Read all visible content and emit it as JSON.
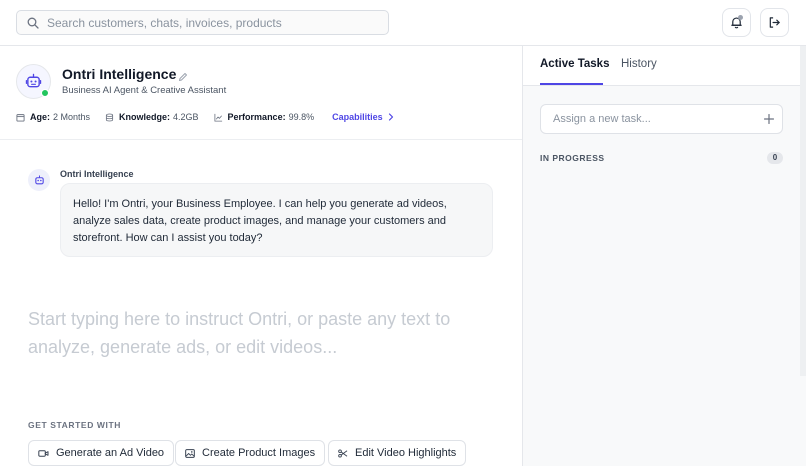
{
  "search": {
    "placeholder": "Search customers, chats, invoices, products"
  },
  "agent": {
    "name": "Ontri Intelligence",
    "subtitle": "Business AI Agent & Creative Assistant",
    "stats": [
      {
        "label": "Age:",
        "value": "2 Months",
        "icon": "calendar-icon"
      },
      {
        "label": "Knowledge:",
        "value": "4.2GB",
        "icon": "database-icon"
      },
      {
        "label": "Performance:",
        "value": "99.8%",
        "icon": "chart-icon"
      }
    ],
    "capabilities_label": "Capabilities",
    "status": "online"
  },
  "chat": {
    "messages": [
      {
        "sender": "Ontri Intelligence",
        "text": "Hello! I'm Ontri, your Business Employee. I can help you generate ad videos, analyze sales data, create product images, and manage your customers and storefront. How can I assist you today?"
      }
    ],
    "compose_placeholder": "Start typing here to instruct Ontri, or paste any text to analyze, generate ads, or edit videos..."
  },
  "get_started": {
    "label": "GET STARTED WITH",
    "actions": [
      {
        "label": "Generate an Ad Video",
        "icon": "video-icon"
      },
      {
        "label": "Create Product Images",
        "icon": "image-icon"
      },
      {
        "label": "Edit Video Highlights",
        "icon": "scissors-icon"
      }
    ]
  },
  "tasks": {
    "tabs": [
      {
        "label": "Active Tasks",
        "active": true
      },
      {
        "label": "History",
        "active": false
      }
    ],
    "assign_placeholder": "Assign a new task...",
    "in_progress_label": "IN PROGRESS",
    "in_progress_count": "0"
  },
  "colors": {
    "accent": "#4f46e5",
    "online": "#22c55e",
    "panel_bg": "#f8f9fa",
    "bubble_bg": "#f6f7f8"
  }
}
